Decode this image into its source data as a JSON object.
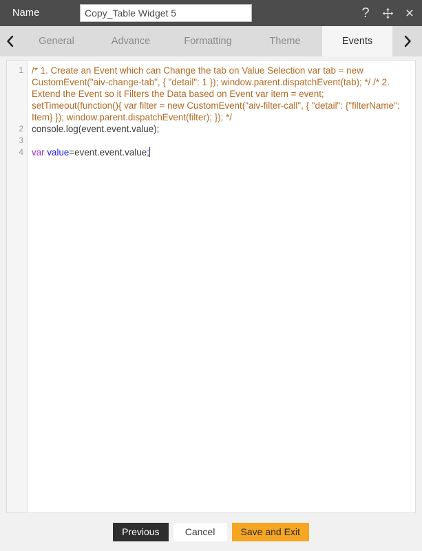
{
  "titlebar": {
    "name_label": "Name",
    "name_value": "Copy_Table Widget 5",
    "name_placeholder": "Name",
    "help_icon": "question-mark-icon",
    "move_icon": "move-cross-arrows-icon",
    "close_icon": "close-x-icon",
    "help_glyph": "?",
    "close_glyph": "×"
  },
  "tabbar": {
    "prev_arrow": "‹",
    "next_arrow": "›",
    "tabs": [
      {
        "label": "General",
        "active": false
      },
      {
        "label": "Advance",
        "active": false
      },
      {
        "label": "Formatting",
        "active": false
      },
      {
        "label": "Theme",
        "active": false
      },
      {
        "label": "Events",
        "active": true
      }
    ]
  },
  "editor": {
    "line_numbers": [
      "1",
      "2",
      "3",
      "4"
    ],
    "lines": [
      {
        "number": "1",
        "type": "comment",
        "text": "/* 1. Create an Event which can Change the tab on Value Selection var tab = new CustomEvent(\"aiv-change-tab\", {    \"detail\": 1 }); window.parent.dispatchEvent(tab);  */ /* 2. Extend the Event so it Filters the Data based on Event var item = event; setTimeout(function(){ var filter = new CustomEvent(\"aiv-filter-call\", {    \"detail\": {\"filterName\": Item}  }); window.parent.dispatchEvent(filter); }); */"
      },
      {
        "number": "2",
        "type": "code",
        "text": "console.log(event.event.value);"
      },
      {
        "number": "3",
        "type": "blank",
        "text": ""
      },
      {
        "number": "4",
        "type": "code",
        "keyword": "var",
        "identifier": "value",
        "rest": "=event.event.value;"
      }
    ]
  },
  "footer": {
    "previous_label": "Previous",
    "cancel_label": "Cancel",
    "save_label": "Save and Exit"
  },
  "colors": {
    "titlebar_bg": "#4c4c4c",
    "tab_inactive_bg": "#dcdcdc",
    "tab_active_bg": "#f5f5f5",
    "accent_orange": "#f5a623",
    "comment_text": "#b26a21",
    "keyword_purple": "#9b30c9",
    "identifier_blue": "#1a1ae0",
    "page_bg": "#f1f1f1"
  }
}
